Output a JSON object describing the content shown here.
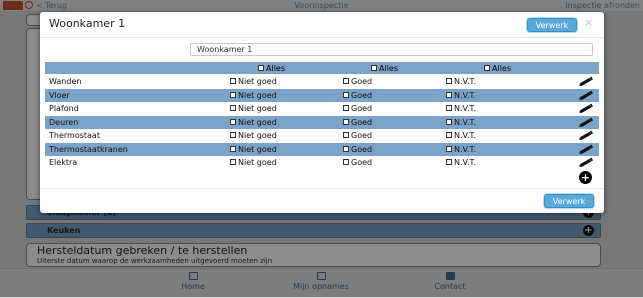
{
  "app": {
    "back_label": "< Terug",
    "title": "Voorinspectie",
    "right_action": "Inspectie afronden",
    "blocks": [
      {
        "label": "Slaapkamer (2)"
      },
      {
        "label": "Keuken"
      }
    ],
    "herstel": {
      "title": "Hersteldatum gebreken / te herstellen",
      "subtitle": "Uiterste datum waarop de werkzaamheden uitgevoerd moeten zijn"
    },
    "nav": [
      {
        "label": "Home"
      },
      {
        "label": "Mijn opnames"
      },
      {
        "label": "Contact"
      }
    ]
  },
  "modal": {
    "title": "Woonkamer 1",
    "verwerk_label": "Verwerk",
    "close_symbol": "×",
    "name_value": "Woonkamer 1",
    "header_all_label": "Alles",
    "options": [
      "Niet goed",
      "Goed",
      "N.V.T."
    ],
    "rows": [
      {
        "label": "Wanden"
      },
      {
        "label": "Vloer"
      },
      {
        "label": "Plafond"
      },
      {
        "label": "Deuren"
      },
      {
        "label": "Thermostaat"
      },
      {
        "label": "Thermostaatkranen"
      },
      {
        "label": "Elektra"
      }
    ],
    "add_symbol": "+",
    "icons": {
      "edit": "pencil-icon",
      "add": "plus-circle-icon"
    }
  },
  "colors": {
    "accent": "#5aa9dc",
    "row_blue": "#7ba2c7"
  }
}
